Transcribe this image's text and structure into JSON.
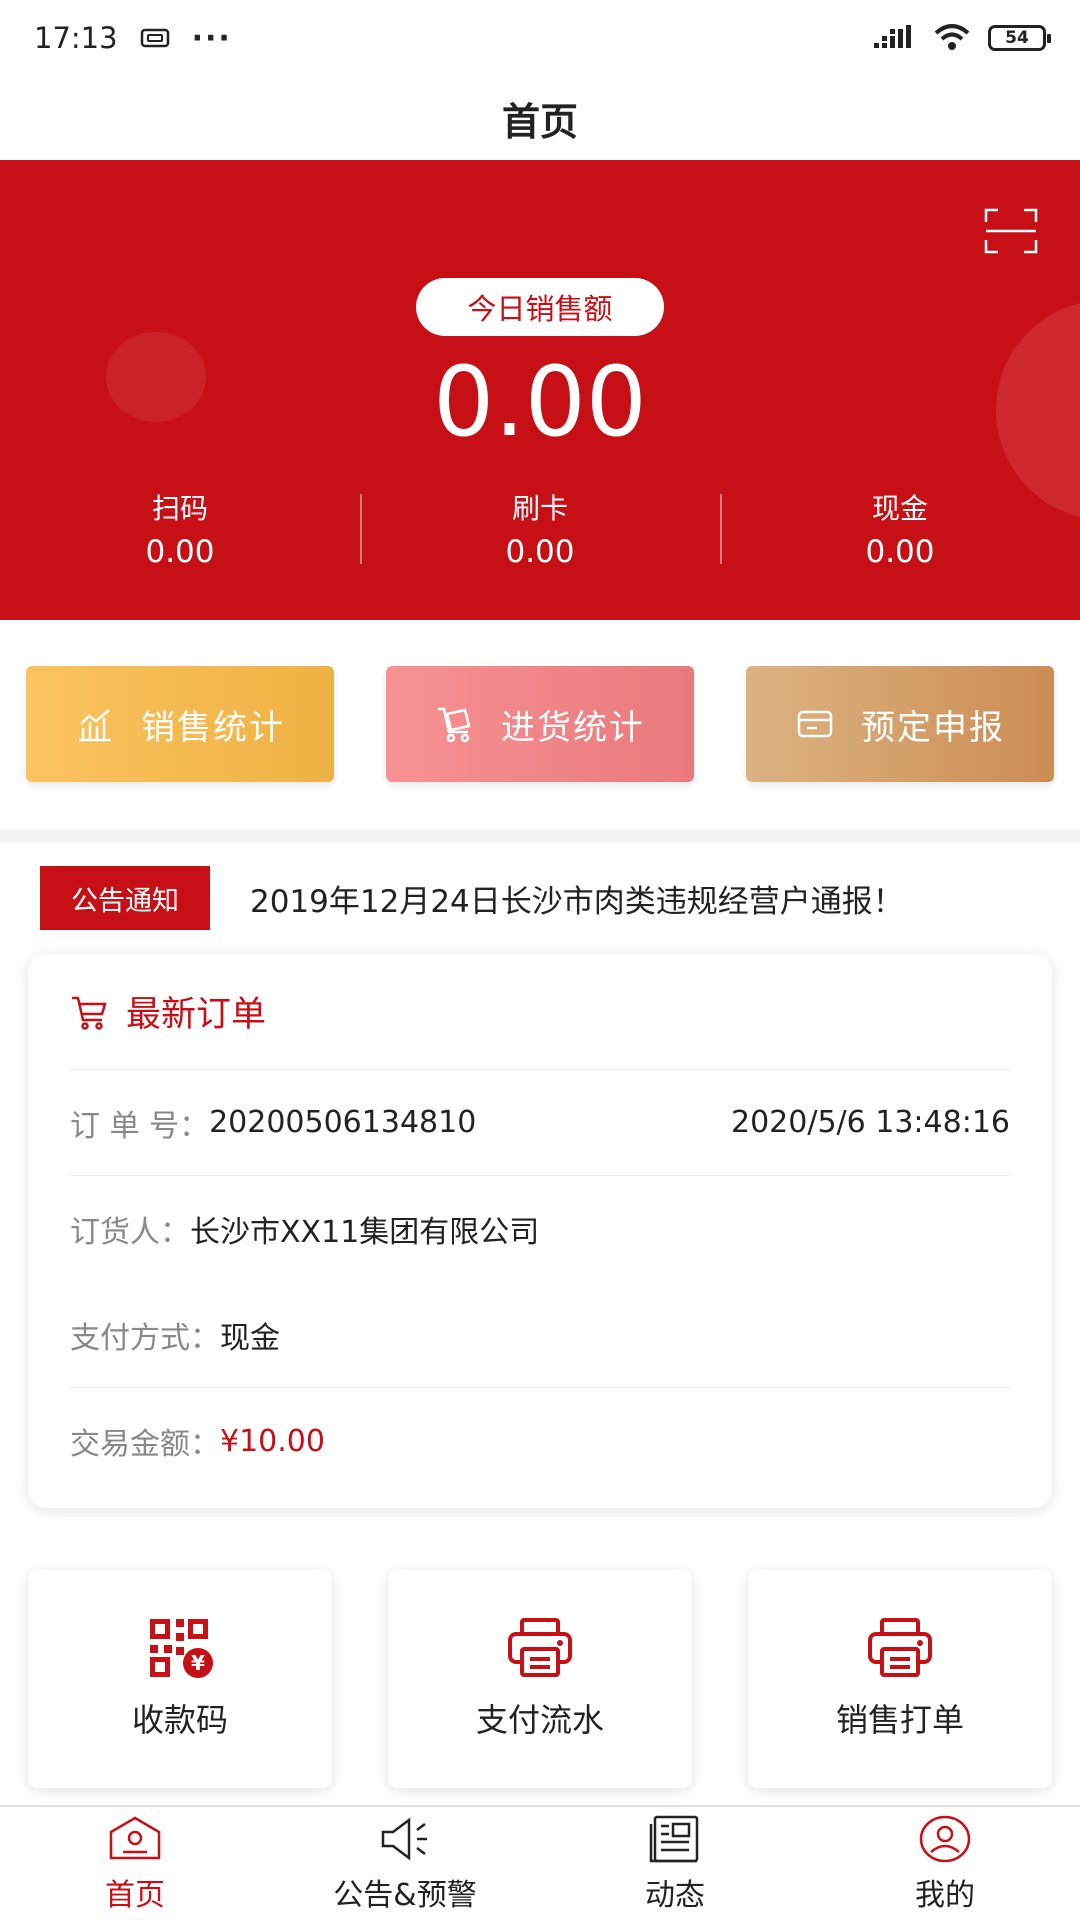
{
  "status_bar": {
    "time": "17:13",
    "more": "···",
    "battery": "54"
  },
  "header": {
    "title": "首页"
  },
  "banner": {
    "pill_label": "今日销售额",
    "total": "0.00",
    "stats": [
      {
        "label": "扫码",
        "value": "0.00"
      },
      {
        "label": "刷卡",
        "value": "0.00"
      },
      {
        "label": "现金",
        "value": "0.00"
      }
    ]
  },
  "quick_actions": [
    {
      "label": "销售统计"
    },
    {
      "label": "进货统计"
    },
    {
      "label": "预定申报"
    }
  ],
  "notice": {
    "tag": "公告通知",
    "text": "2019年12月24日长沙市肉类违规经营户通报！"
  },
  "order": {
    "title": "最新订单",
    "order_no_label": "订 单 号：",
    "order_no": "20200506134810",
    "time": "2020/5/6 13:48:16",
    "buyer_label": "订货人：",
    "buyer": "长沙市XX11集团有限公司",
    "pay_label": "支付方式：",
    "pay_method": "现金",
    "amount_label": "交易金额：",
    "amount": "¥10.00"
  },
  "tools": [
    {
      "label": "收款码"
    },
    {
      "label": "支付流水"
    },
    {
      "label": "销售打单"
    }
  ],
  "tabs": [
    {
      "label": "首页"
    },
    {
      "label": "公告&预警"
    },
    {
      "label": "动态"
    },
    {
      "label": "我的"
    }
  ],
  "colors": {
    "brand_red": "#c71016",
    "sales_gradient": [
      "#fbc35f",
      "#eeb144"
    ],
    "purchase_gradient": [
      "#f79294",
      "#e9797c"
    ],
    "reserve_gradient": [
      "#dcb383",
      "#cc8d52"
    ]
  }
}
